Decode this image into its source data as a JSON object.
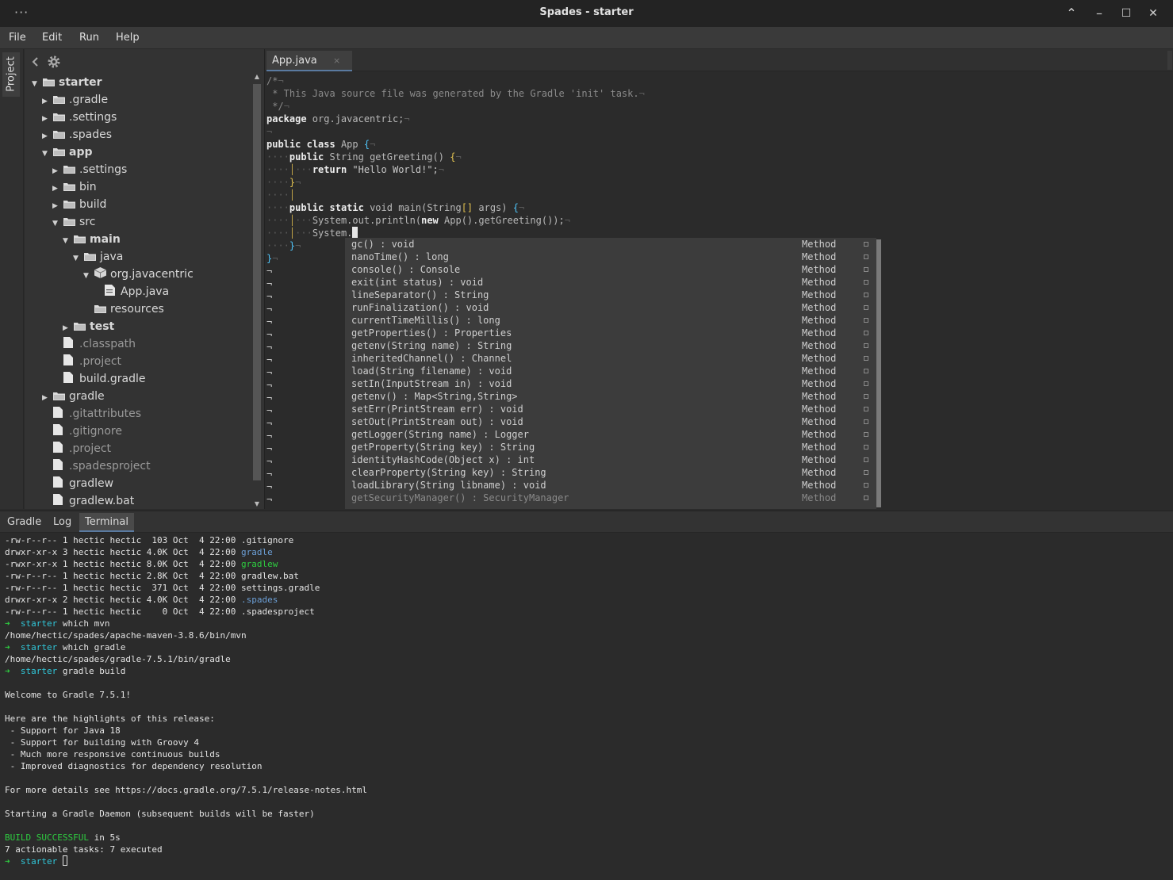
{
  "window": {
    "title": "Spades - starter",
    "menu_dots": "···",
    "controls": {
      "up": "⌃",
      "minimize": "–",
      "maximize": "☐",
      "close": "✕"
    }
  },
  "menu": [
    "File",
    "Edit",
    "Run",
    "Help"
  ],
  "left_strip": {
    "tab": "Project"
  },
  "project_tree": [
    {
      "label": "starter",
      "kind": "folder",
      "arrow": "open",
      "bold": true,
      "dim": false
    },
    {
      "label": ".gradle",
      "kind": "folder",
      "arrow": "closed",
      "bold": false,
      "dim": false
    },
    {
      "label": ".settings",
      "kind": "folder",
      "arrow": "closed",
      "bold": false,
      "dim": false
    },
    {
      "label": ".spades",
      "kind": "folder",
      "arrow": "closed",
      "bold": false,
      "dim": false
    },
    {
      "label": "app",
      "kind": "folder",
      "arrow": "open",
      "bold": true,
      "dim": false
    },
    {
      "label": ".settings",
      "kind": "folder",
      "arrow": "closed",
      "bold": false,
      "dim": false
    },
    {
      "label": "bin",
      "kind": "folder",
      "arrow": "closed",
      "bold": false,
      "dim": false
    },
    {
      "label": "build",
      "kind": "folder",
      "arrow": "closed",
      "bold": false,
      "dim": false
    },
    {
      "label": "src",
      "kind": "folder",
      "arrow": "open",
      "bold": false,
      "dim": false
    },
    {
      "label": "main",
      "kind": "folder",
      "arrow": "open",
      "bold": true,
      "dim": false
    },
    {
      "label": "java",
      "kind": "folder",
      "arrow": "open",
      "bold": false,
      "dim": false
    },
    {
      "label": "org.javacentric",
      "kind": "package",
      "arrow": "open",
      "bold": false,
      "dim": false
    },
    {
      "label": "App.java",
      "kind": "java",
      "arrow": "none",
      "bold": false,
      "dim": false
    },
    {
      "label": "resources",
      "kind": "folder",
      "arrow": "none",
      "bold": false,
      "dim": false
    },
    {
      "label": "test",
      "kind": "folder",
      "arrow": "closed",
      "bold": true,
      "dim": false
    },
    {
      "label": ".classpath",
      "kind": "file",
      "arrow": "none",
      "bold": false,
      "dim": true
    },
    {
      "label": ".project",
      "kind": "file",
      "arrow": "none",
      "bold": false,
      "dim": true
    },
    {
      "label": "build.gradle",
      "kind": "file",
      "arrow": "none",
      "bold": false,
      "dim": false
    },
    {
      "label": "gradle",
      "kind": "folder",
      "arrow": "closed",
      "bold": false,
      "dim": false
    },
    {
      "label": ".gitattributes",
      "kind": "file",
      "arrow": "none",
      "bold": false,
      "dim": true
    },
    {
      "label": ".gitignore",
      "kind": "file",
      "arrow": "none",
      "bold": false,
      "dim": true
    },
    {
      "label": ".project",
      "kind": "file",
      "arrow": "none",
      "bold": false,
      "dim": true
    },
    {
      "label": ".spadesproject",
      "kind": "file",
      "arrow": "none",
      "bold": false,
      "dim": true
    },
    {
      "label": "gradlew",
      "kind": "file",
      "arrow": "none",
      "bold": false,
      "dim": false
    },
    {
      "label": "gradlew.bat",
      "kind": "file",
      "arrow": "none",
      "bold": false,
      "dim": false
    }
  ],
  "editor": {
    "tab_label": "App.java",
    "tab_close": "×",
    "code": {
      "l1": "/*",
      "l2": " * This Java source file was generated by the Gradle 'init' task.",
      "l3": " */",
      "l4_kw": "package",
      "l4_rest": " org.javacentric;",
      "l6_a": "public",
      "l6_b": "class",
      "l6_rest": " App ",
      "l7_a": "public",
      "l7_rest": " String getGreeting() ",
      "l8_kw": "return",
      "l8_rest": " \"Hello World!\";",
      "l11_a": "public",
      "l11_b": "static",
      "l11_rest": " void main(String",
      "l11_tail": " args) ",
      "l12_a": "System.out.println(",
      "l12_new": "new",
      "l12_b": " App().getGreeting());",
      "l13": "System."
    }
  },
  "autocomplete": [
    {
      "sig": "gc() : void",
      "kind": "Method"
    },
    {
      "sig": "nanoTime() : long",
      "kind": "Method"
    },
    {
      "sig": "console() : Console",
      "kind": "Method"
    },
    {
      "sig": "exit(int status) : void",
      "kind": "Method"
    },
    {
      "sig": "lineSeparator() : String",
      "kind": "Method"
    },
    {
      "sig": "runFinalization() : void",
      "kind": "Method"
    },
    {
      "sig": "currentTimeMillis() : long",
      "kind": "Method"
    },
    {
      "sig": "getProperties() : Properties",
      "kind": "Method"
    },
    {
      "sig": "getenv(String name) : String",
      "kind": "Method"
    },
    {
      "sig": "inheritedChannel() : Channel",
      "kind": "Method"
    },
    {
      "sig": "load(String filename) : void",
      "kind": "Method"
    },
    {
      "sig": "setIn(InputStream in) : void",
      "kind": "Method"
    },
    {
      "sig": "getenv() : Map<String,String>",
      "kind": "Method"
    },
    {
      "sig": "setErr(PrintStream err) : void",
      "kind": "Method"
    },
    {
      "sig": "setOut(PrintStream out) : void",
      "kind": "Method"
    },
    {
      "sig": "getLogger(String name) : Logger",
      "kind": "Method"
    },
    {
      "sig": "getProperty(String key) : String",
      "kind": "Method"
    },
    {
      "sig": "identityHashCode(Object x) : int",
      "kind": "Method"
    },
    {
      "sig": "clearProperty(String key) : String",
      "kind": "Method"
    },
    {
      "sig": "loadLibrary(String libname) : void",
      "kind": "Method"
    },
    {
      "sig": "getSecurityManager() : SecurityManager",
      "kind": "Method"
    }
  ],
  "bottom_tabs": [
    "Gradle",
    "Log",
    "Terminal"
  ],
  "terminal": {
    "ls": [
      {
        "meta": "-rw-r--r-- 1 hectic hectic  103 Oct  4 22:00 ",
        "name": ".gitignore",
        "style": "plain"
      },
      {
        "meta": "drwxr-xr-x 3 hectic hectic 4.0K Oct  4 22:00 ",
        "name": "gradle",
        "style": "blue"
      },
      {
        "meta": "-rwxr-xr-x 1 hectic hectic 8.0K Oct  4 22:00 ",
        "name": "gradlew",
        "style": "green"
      },
      {
        "meta": "-rw-r--r-- 1 hectic hectic 2.8K Oct  4 22:00 ",
        "name": "gradlew.bat",
        "style": "plain"
      },
      {
        "meta": "-rw-r--r-- 1 hectic hectic  371 Oct  4 22:00 ",
        "name": "settings.gradle",
        "style": "plain"
      },
      {
        "meta": "drwxr-xr-x 2 hectic hectic 4.0K Oct  4 22:00 ",
        "name": ".spades",
        "style": "blue"
      },
      {
        "meta": "-rw-r--r-- 1 hectic hectic    0 Oct  4 22:00 ",
        "name": ".spadesproject",
        "style": "plain"
      }
    ],
    "prompt_arrow": "➜",
    "prompt_dir": "starter",
    "cmd1": " which mvn",
    "out1": "/home/hectic/spades/apache-maven-3.8.6/bin/mvn",
    "cmd2": " which gradle",
    "out2": "/home/hectic/spades/gradle-7.5.1/bin/gradle",
    "cmd3": " gradle build",
    "welcome": "Welcome to Gradle 7.5.1!",
    "highlights_head": "Here are the highlights of this release:",
    "highlights": [
      " - Support for Java 18",
      " - Support for building with Groovy 4",
      " - Much more responsive continuous builds",
      " - Improved diagnostics for dependency resolution"
    ],
    "details": "For more details see https://docs.gradle.org/7.5.1/release-notes.html",
    "daemon": "Starting a Gradle Daemon (subsequent builds will be faster)",
    "build_status": "BUILD SUCCESSFUL",
    "build_time": " in 5s",
    "tasks": "7 actionable tasks: 7 executed"
  }
}
